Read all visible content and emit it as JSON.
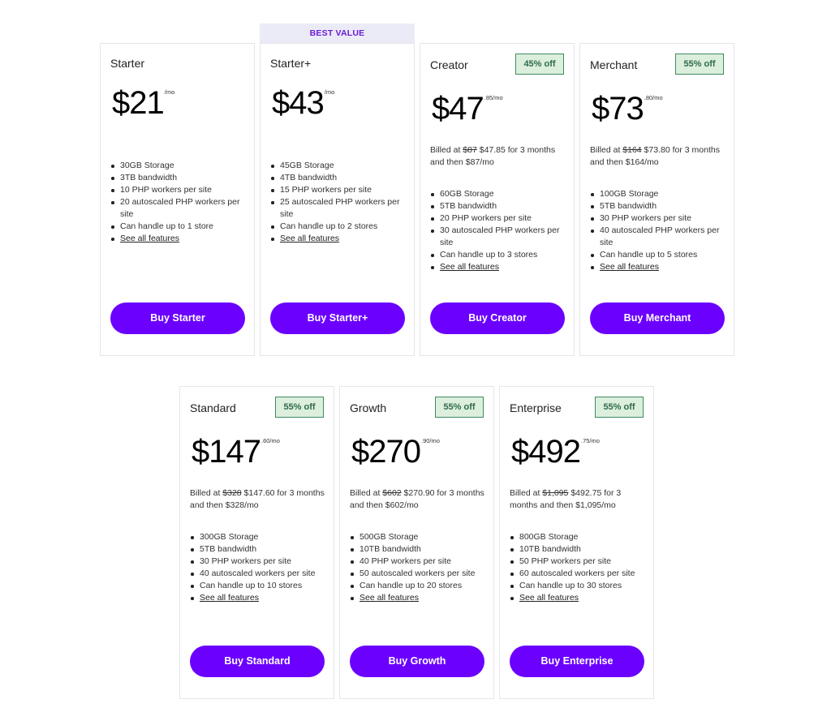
{
  "best_value_label": "BEST VALUE",
  "plans": [
    {
      "name": "Starter",
      "badge": null,
      "price_main": "$21",
      "price_sup": "/mo",
      "billing": null,
      "features": [
        "30GB Storage",
        "3TB bandwidth",
        "10 PHP workers per site",
        "20 autoscaled PHP workers per site",
        "Can handle up to 1 store"
      ],
      "features_link": "See all features",
      "button": "Buy Starter"
    },
    {
      "name": "Starter+",
      "badge": null,
      "price_main": "$43",
      "price_sup": "/mo",
      "billing": null,
      "features": [
        "45GB Storage",
        "4TB bandwidth",
        "15 PHP workers per site",
        "25 autoscaled PHP workers per site",
        "Can handle up to 2 stores"
      ],
      "features_link": "See all features",
      "button": "Buy Starter+"
    },
    {
      "name": "Creator",
      "badge": "45% off",
      "price_main": "$47",
      "price_sup": ".85/mo",
      "billing": {
        "prefix": "Billed at ",
        "original": "$87",
        "rest": " $47.85 for 3 months and then $87/mo"
      },
      "features": [
        "60GB Storage",
        "5TB bandwidth",
        "20 PHP workers per site",
        "30 autoscaled PHP workers per site",
        "Can handle up to 3 stores"
      ],
      "features_link": "See all features",
      "button": "Buy Creator"
    },
    {
      "name": "Merchant",
      "badge": "55% off",
      "price_main": "$73",
      "price_sup": ".80/mo",
      "billing": {
        "prefix": "Billed at ",
        "original": "$164",
        "rest": " $73.80 for 3 months and then $164/mo"
      },
      "features": [
        "100GB Storage",
        "5TB bandwidth",
        "30 PHP workers per site",
        "40 autoscaled PHP workers per site",
        "Can handle up to 5 stores"
      ],
      "features_link": "See all features",
      "button": "Buy Merchant"
    },
    {
      "name": "Standard",
      "badge": "55% off",
      "price_main": "$147",
      "price_sup": ".60/mo",
      "billing": {
        "prefix": "Billed at ",
        "original": "$328",
        "rest": " $147.60 for 3 months and then $328/mo"
      },
      "features": [
        "300GB Storage",
        "5TB bandwidth",
        "30 PHP workers per site",
        "40 autoscaled workers per site",
        "Can handle up to 10 stores"
      ],
      "features_link": "See all features",
      "button": "Buy Standard"
    },
    {
      "name": "Growth",
      "badge": "55% off",
      "price_main": "$270",
      "price_sup": ".90/mo",
      "billing": {
        "prefix": "Billed at ",
        "original": "$602",
        "rest": " $270.90 for 3 months and then $602/mo"
      },
      "features": [
        "500GB Storage",
        "10TB bandwidth",
        "40 PHP workers per site",
        "50 autoscaled workers per site",
        "Can handle up to 20 stores"
      ],
      "features_link": "See all features",
      "button": "Buy Growth"
    },
    {
      "name": "Enterprise",
      "badge": "55% off",
      "price_main": "$492",
      "price_sup": ".75/mo",
      "billing": {
        "prefix": "Billed at ",
        "original": "$1,095",
        "rest": " $492.75 for 3 months and then $1,095/mo"
      },
      "features": [
        "800GB Storage",
        "10TB bandwidth",
        "50 PHP workers per site",
        "60 autoscaled workers per site",
        "Can handle up to 30 stores"
      ],
      "features_link": "See all features",
      "button": "Buy Enterprise"
    }
  ]
}
